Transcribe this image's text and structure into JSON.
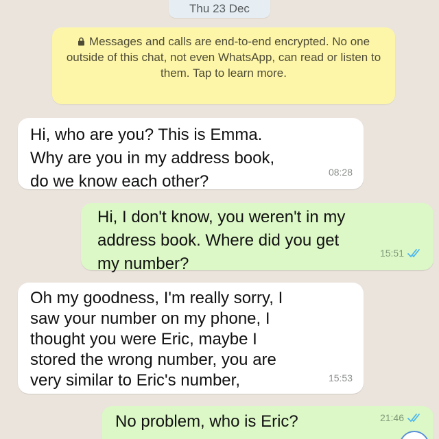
{
  "chat": {
    "date_separator": "Thu 23 Dec",
    "encryption_notice": "Messages and calls are end-to-end encrypted. No one outside of this chat, not even WhatsApp, can read or listen to them. Tap to learn more.",
    "messages": [
      {
        "direction": "incoming",
        "lines": [
          "Hi, who are you? This is Emma.",
          "Why are you in my address book,",
          "do we know each other?"
        ],
        "time": "08:28"
      },
      {
        "direction": "outgoing",
        "lines": [
          "Hi, I don't know, you weren't in my",
          "address book. Where did you get",
          "my number?"
        ],
        "time": "15:51",
        "status": "read"
      },
      {
        "direction": "incoming",
        "lines": [
          "Oh my goodness, I'm really sorry, I",
          "saw your number on my phone, I",
          "thought you were Eric, maybe I",
          "stored the wrong number, you are",
          "very similar to Eric's number,"
        ],
        "time": "15:53"
      },
      {
        "direction": "outgoing",
        "lines": [
          "No problem, who is Eric?"
        ],
        "time": "21:46",
        "status": "read"
      }
    ]
  },
  "colors": {
    "background": "#ebe4dc",
    "incoming_bubble": "#ffffff",
    "outgoing_bubble": "#dcf8c6",
    "encryption_banner": "#fdf6a9",
    "read_ticks": "#4fb6ec"
  },
  "icons": {
    "lock": "lock-icon",
    "read_receipt": "double-check-icon",
    "scroll_down": "scroll-down-button"
  }
}
